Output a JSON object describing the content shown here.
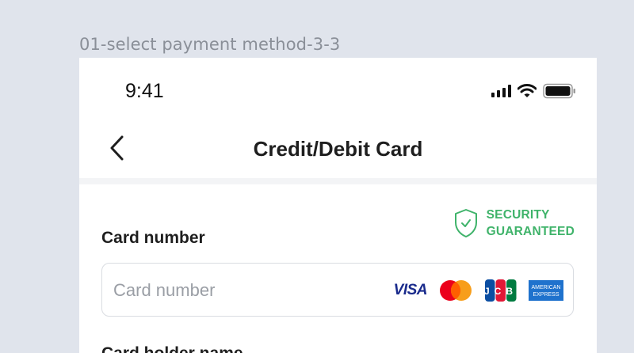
{
  "frame": {
    "label": "01-select payment method-3-3"
  },
  "status_bar": {
    "time": "9:41"
  },
  "navbar": {
    "title": "Credit/Debit Card"
  },
  "security": {
    "line1": "SECURITY",
    "line2": "GUARANTEED",
    "color": "#3fb36a"
  },
  "card_number": {
    "label": "Card number",
    "placeholder": "Card number",
    "value": ""
  },
  "card_brands": {
    "visa": "VISA",
    "jcb": "JCB",
    "amex_line1": "AMERICAN",
    "amex_line2": "EXPRESS"
  },
  "card_holder": {
    "label": "Card holder name"
  },
  "icons": {
    "back": "chevron-left-icon",
    "signal": "signal-icon",
    "wifi": "wifi-icon",
    "battery": "battery-icon",
    "shield": "shield-check-icon"
  },
  "colors": {
    "background": "#e0e4ec",
    "panel": "#ffffff",
    "accent_green": "#3fb36a"
  }
}
